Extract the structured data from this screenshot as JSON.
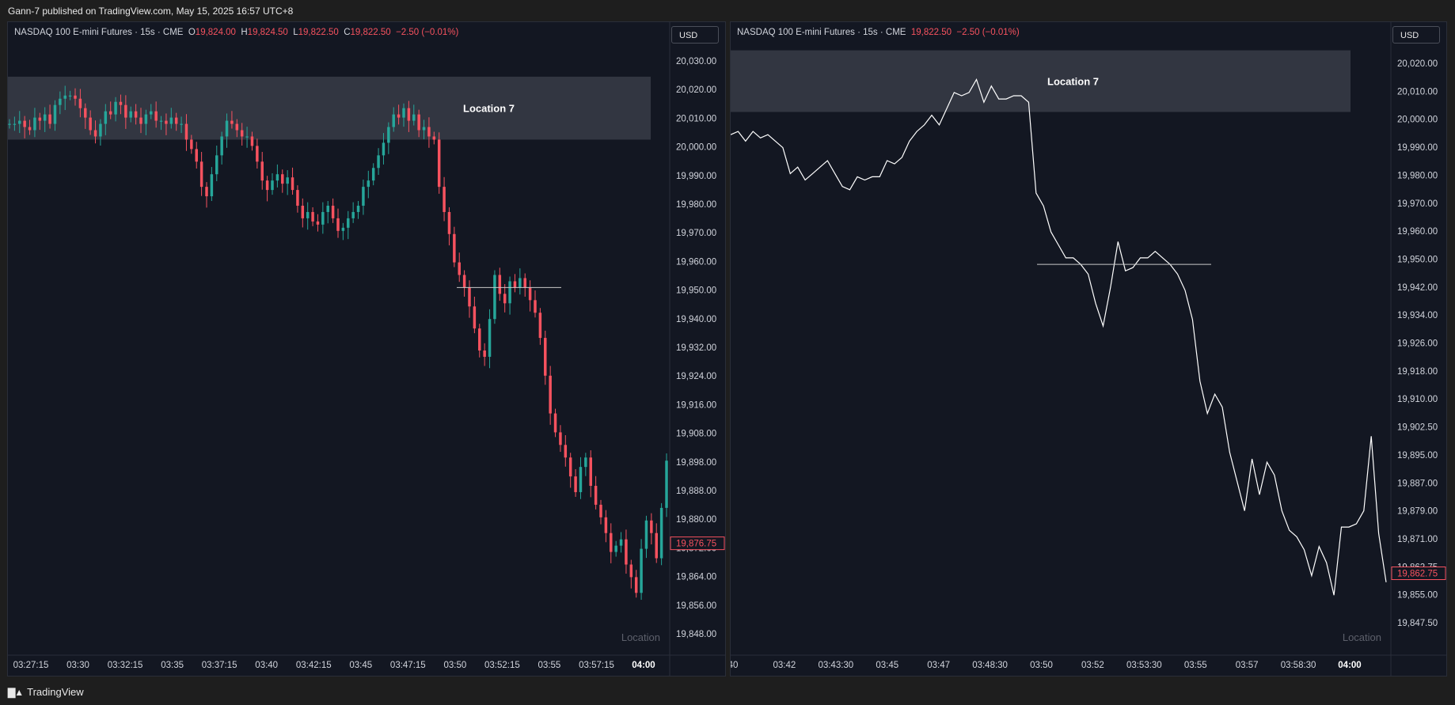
{
  "header": {
    "publisher_text": "Gann-7 published on TradingView.com, May 15, 2025 16:57 UTC+8"
  },
  "footer": {
    "brand": "TradingView",
    "logo_icon": "tradingview-logo-icon"
  },
  "colors": {
    "background": "#131722",
    "up": "#26a69a",
    "down": "#f7525f",
    "line": "#ffffff",
    "zone": "#363a45",
    "text": "#d1d4dc"
  },
  "chart_data": [
    {
      "type": "candlestick",
      "legend": {
        "symbol": "NASDAQ 100 E-mini Futures · 15s · CME",
        "o_label": "O",
        "o": "19,824.00",
        "h_label": "H",
        "h": "19,824.50",
        "l_label": "L",
        "l": "19,822.50",
        "c_label": "C",
        "c": "19,822.50",
        "change": "−2.50 (−0.01%)"
      },
      "currency": "USD",
      "y_ticks": [
        "20,030.00",
        "20,020.00",
        "20,010.00",
        "20,000.00",
        "19,990.00",
        "19,980.00",
        "19,970.00",
        "19,960.00",
        "19,950.00",
        "19,940.00",
        "19,932.00",
        "19,924.00",
        "19,916.00",
        "19,908.00",
        "19,898.00",
        "19,888.00",
        "19,880.00",
        "19,872.00",
        "19,864.00",
        "19,856.00",
        "19,848.00"
      ],
      "x_ticks": [
        "03:27:15",
        "03:30",
        "03:32:15",
        "03:35",
        "03:37:15",
        "03:40",
        "03:42:15",
        "03:45",
        "03:47:15",
        "03:50",
        "03:52:15",
        "03:55",
        "03:57:15",
        "04:00"
      ],
      "last_price": "19,876.75",
      "zone": {
        "label": "Location 7",
        "top": 20025,
        "bottom": 20005
      },
      "hline": {
        "price": 19958
      },
      "watermark": "Location",
      "closes": [
        20010,
        20010,
        20011,
        20009,
        20008,
        20012,
        20011,
        20013,
        20010,
        20016,
        20018,
        20019,
        20019,
        20018,
        20015,
        20012,
        20008,
        20006,
        20010,
        20014,
        20013,
        20017,
        20016,
        20012,
        20014,
        20012,
        20010,
        20013,
        20014,
        20011,
        20011,
        20010,
        20012,
        20010,
        20010,
        20005,
        20002,
        19998,
        19990,
        19987,
        19994,
        20000,
        20006,
        20011,
        20010,
        20008,
        20006,
        20006,
        20003,
        19998,
        19992,
        19989,
        19992,
        19994,
        19991,
        19993,
        19989,
        19984,
        19980,
        19982,
        19979,
        19978,
        19982,
        19984,
        19980,
        19976,
        19977,
        19980,
        19982,
        19984,
        19990,
        19992,
        19996,
        20000,
        20004,
        20009,
        20013,
        20012,
        20015,
        20011,
        20013,
        20008,
        20009,
        20006,
        20005,
        19990,
        19982,
        19975,
        19966,
        19962,
        19958,
        19952,
        19945,
        19938,
        19936,
        19948,
        19962,
        19956,
        19953,
        19960,
        19958,
        19961,
        19958,
        19954,
        19950,
        19942,
        19930,
        19918,
        19912,
        19908,
        19904,
        19898,
        19893,
        19901,
        19904,
        19895,
        19889,
        19885,
        19880,
        19874,
        19876,
        19878,
        19870,
        19866,
        19861,
        19875,
        19884,
        19880,
        19872,
        19888,
        19903
      ]
    },
    {
      "type": "line",
      "legend": {
        "symbol": "NASDAQ 100 E-mini Futures · 15s · CME",
        "price": "19,822.50",
        "change": "−2.50 (−0.01%)"
      },
      "currency": "USD",
      "y_ticks": [
        "20,020.00",
        "20,010.00",
        "20,000.00",
        "19,990.00",
        "19,980.00",
        "19,970.00",
        "19,960.00",
        "19,950.00",
        "19,942.00",
        "19,934.00",
        "19,926.00",
        "19,918.00",
        "19,910.00",
        "19,902.50",
        "19,895.00",
        "19,887.00",
        "19,879.00",
        "19,871.00",
        "19,862.75",
        "19,855.00",
        "19,847.50"
      ],
      "x_ticks": [
        "40",
        "03:42",
        "03:43:30",
        "03:45",
        "03:47",
        "03:48:30",
        "03:50",
        "03:52",
        "03:53:30",
        "03:55",
        "03:57",
        "03:58:30",
        "04:00"
      ],
      "last_price": "19,862.75",
      "zone": {
        "label": "Location 7",
        "top": 20024,
        "bottom": 20005
      },
      "hline": {
        "price": 19958
      },
      "watermark": "Location",
      "closes": [
        19998,
        19999,
        19996,
        19999,
        19997,
        19998,
        19996,
        19994,
        19986,
        19988,
        19984,
        19986,
        19988,
        19990,
        19986,
        19982,
        19981,
        19985,
        19984,
        19985,
        19985,
        19990,
        19989,
        19991,
        19996,
        19999,
        20001,
        20004,
        20001,
        20006,
        20011,
        20010,
        20011,
        20015,
        20008,
        20013,
        20009,
        20009,
        20010,
        20010,
        20008,
        19980,
        19976,
        19968,
        19964,
        19960,
        19960,
        19958,
        19955,
        19946,
        19939,
        19951,
        19965,
        19956,
        19957,
        19960,
        19960,
        19962,
        19960,
        19958,
        19955,
        19950,
        19941,
        19922,
        19912,
        19918,
        19914,
        19900,
        19891,
        19882,
        19898,
        19887,
        19897,
        19893,
        19882,
        19876,
        19874,
        19870,
        19862,
        19871,
        19866,
        19856,
        19877,
        19877,
        19878,
        19882,
        19905,
        19875,
        19860
      ]
    }
  ]
}
